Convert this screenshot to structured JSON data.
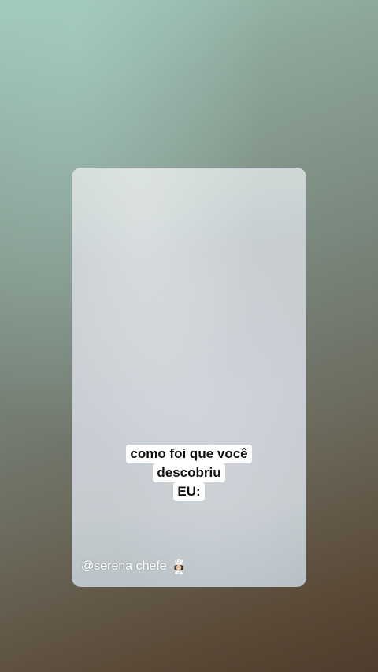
{
  "story": {
    "caption_lines": [
      "como foi que você",
      "descobriu",
      "EU:"
    ],
    "handle": "@serena chefe",
    "handle_icon": "woman-cook-icon"
  }
}
